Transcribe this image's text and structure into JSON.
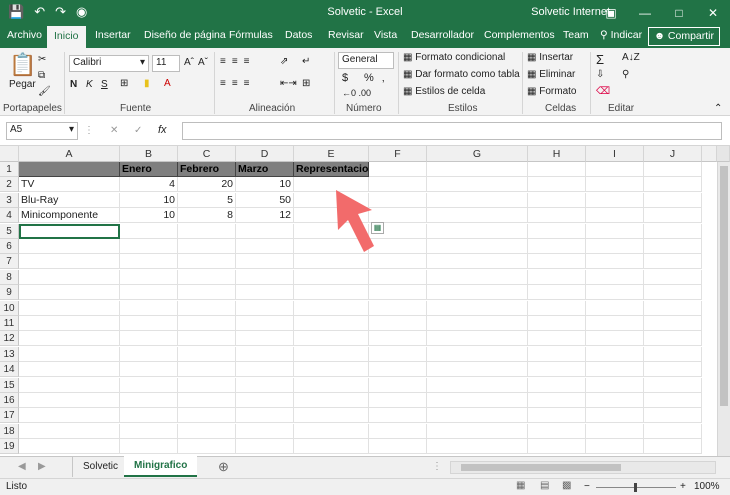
{
  "window": {
    "title": "Solvetic  -  Excel",
    "user": "Solvetic Internet"
  },
  "icons": {
    "save": "save-icon",
    "undo": "undo-icon",
    "redo": "redo-icon",
    "camera": "camera-icon"
  },
  "tabs": [
    "Archivo",
    "Inicio",
    "Insertar",
    "Diseño de página",
    "Fórmulas",
    "Datos",
    "Revisar",
    "Vista",
    "Desarrollador",
    "Complementos",
    "Team"
  ],
  "tell_me": "Indicar",
  "share": "Compartir",
  "ribbon": {
    "clipboard": {
      "paste": "Pegar",
      "label": "Portapapeles"
    },
    "font": {
      "name": "Calibri",
      "size": "11",
      "label": "Fuente"
    },
    "alignment": {
      "label": "Alineación"
    },
    "number": {
      "format": "General",
      "label": "Número"
    },
    "styles": {
      "cond": "Formato condicional",
      "table": "Dar formato como tabla",
      "cell": "Estilos de celda",
      "label": "Estilos"
    },
    "cells": {
      "insert": "Insertar",
      "delete": "Eliminar",
      "format": "Formato",
      "label": "Celdas"
    },
    "editing": {
      "label": "Editar"
    }
  },
  "formula_bar": {
    "name_box": "A5",
    "fx": "fx",
    "formula": ""
  },
  "columns": [
    "A",
    "B",
    "C",
    "D",
    "E",
    "F",
    "G",
    "H",
    "I",
    "J"
  ],
  "rows": [
    "1",
    "2",
    "3",
    "4",
    "5",
    "6",
    "7",
    "8",
    "9",
    "10",
    "11",
    "12",
    "13",
    "14",
    "15",
    "16",
    "17",
    "18",
    "19"
  ],
  "table": {
    "header": [
      "",
      "Enero",
      "Febrero",
      "Marzo",
      "Representacion"
    ],
    "data": [
      [
        "TV",
        "4",
        "20",
        "10",
        ""
      ],
      [
        "Blu-Ray",
        "10",
        "5",
        "50",
        ""
      ],
      [
        "Minicomponente",
        "10",
        "8",
        "12",
        ""
      ]
    ]
  },
  "sheets": [
    "Solvetic",
    "Minigrafico"
  ],
  "active_sheet": "Minigrafico",
  "status": {
    "ready": "Listo",
    "zoom": "100%"
  },
  "colors": {
    "excel_green": "#217346",
    "header_fill": "#7f7f7f",
    "arrow": "#f26b6b"
  }
}
